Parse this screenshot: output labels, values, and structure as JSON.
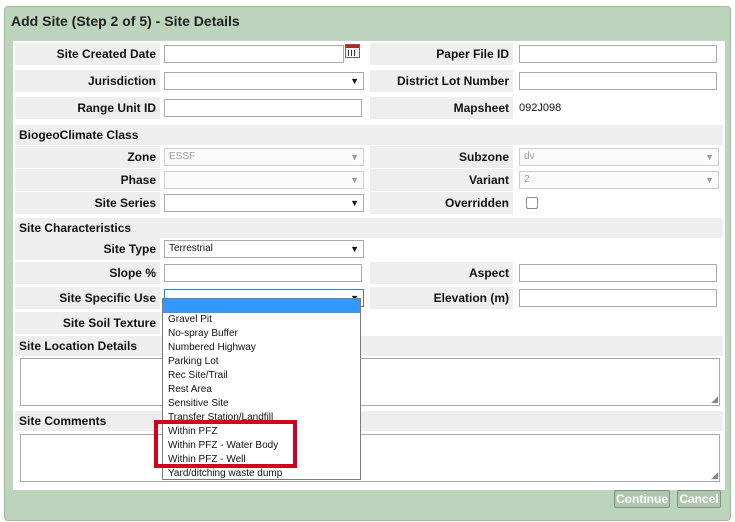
{
  "dialog": {
    "title": "Add Site (Step 2 of 5) - Site Details"
  },
  "fields": {
    "site_created_date": {
      "label": "Site Created Date",
      "value": ""
    },
    "paper_file_id": {
      "label": "Paper File ID",
      "value": ""
    },
    "jurisdiction": {
      "label": "Jurisdiction",
      "value": ""
    },
    "district_lot_number": {
      "label": "District Lot Number",
      "value": ""
    },
    "range_unit_id": {
      "label": "Range Unit ID",
      "value": ""
    },
    "mapsheet": {
      "label": "Mapsheet",
      "value": "092J098"
    }
  },
  "biogeo": {
    "section": "BiogeoClimate Class",
    "zone": {
      "label": "Zone",
      "value": "ESSF"
    },
    "subzone": {
      "label": "Subzone",
      "value": "dv"
    },
    "phase": {
      "label": "Phase",
      "value": ""
    },
    "variant": {
      "label": "Variant",
      "value": "2"
    },
    "site_series": {
      "label": "Site Series",
      "value": ""
    },
    "overridden": {
      "label": "Overridden",
      "checked": false
    }
  },
  "characteristics": {
    "section": "Site Characteristics",
    "site_type": {
      "label": "Site Type",
      "value": "Terrestrial"
    },
    "slope": {
      "label": "Slope %",
      "value": ""
    },
    "aspect": {
      "label": "Aspect",
      "value": ""
    },
    "site_specific_use": {
      "label": "Site Specific Use",
      "value": ""
    },
    "elevation": {
      "label": "Elevation (m)",
      "value": ""
    },
    "site_soil_texture": {
      "label": "Site Soil Texture"
    }
  },
  "location": {
    "section": "Site Location Details",
    "value": ""
  },
  "comments": {
    "section": "Site Comments",
    "value": ""
  },
  "site_specific_use_options": [
    "",
    "Gravel Pit",
    "No-spray Buffer",
    "Numbered Highway",
    "Parking Lot",
    "Rec Site/Trail",
    "Rest Area",
    "Sensitive Site",
    "Transfer Station/Landfill",
    "Within PFZ",
    "Within PFZ - Water Body",
    "Within PFZ - Well",
    "Yard/ditching waste dump"
  ],
  "buttons": {
    "continue": "Continue",
    "cancel": "Cancel"
  },
  "colors": {
    "dialog_bg": "#bcd3bc",
    "selected_option": "#3399ff",
    "highlight": "#d0021b"
  }
}
